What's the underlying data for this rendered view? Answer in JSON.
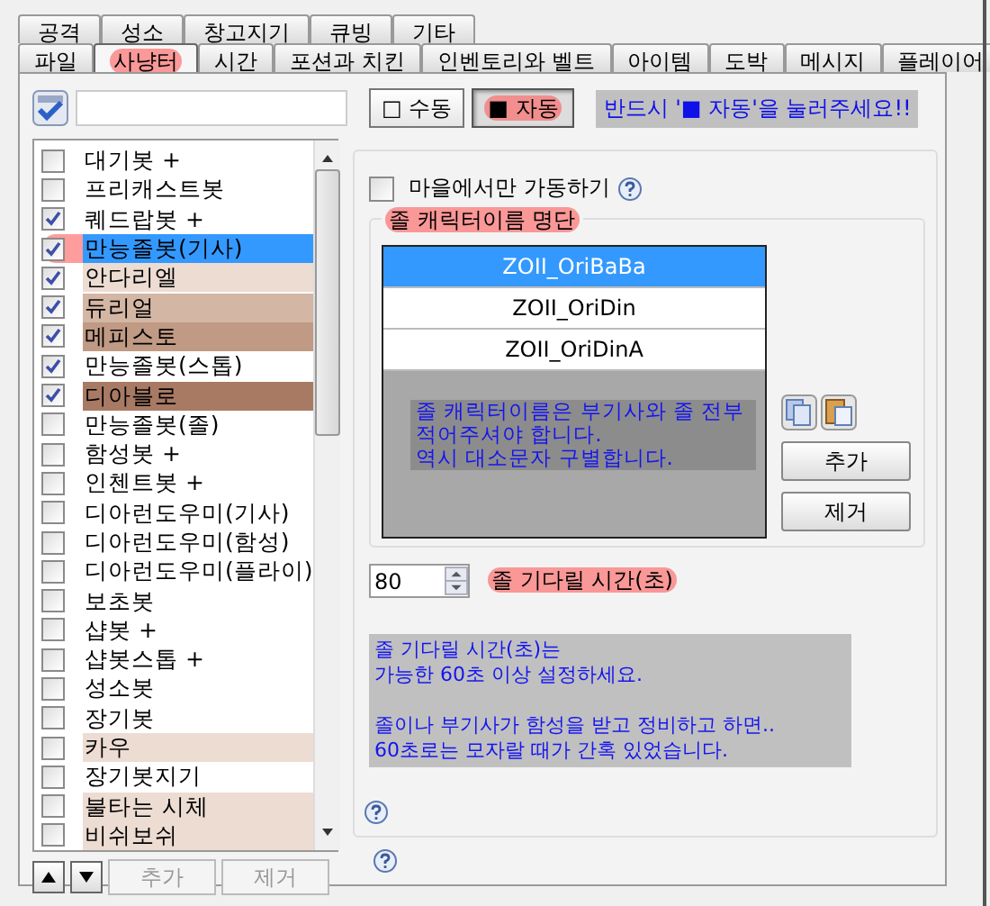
{
  "tabs": {
    "rows": [
      [
        {
          "label": "공격",
          "selected": false,
          "marked": false
        },
        {
          "label": "성소",
          "selected": false,
          "marked": false
        },
        {
          "label": "창고지기",
          "selected": false,
          "marked": false
        },
        {
          "label": "큐빙",
          "selected": false,
          "marked": false
        },
        {
          "label": "기타",
          "selected": false,
          "marked": false
        }
      ],
      [
        {
          "label": "파일",
          "selected": false,
          "marked": false
        },
        {
          "label": "사냥터",
          "selected": true,
          "marked": true
        },
        {
          "label": "시간",
          "selected": false,
          "marked": false
        },
        {
          "label": "포션과 치킨",
          "selected": false,
          "marked": false
        },
        {
          "label": "인벤토리와 벨트",
          "selected": false,
          "marked": false
        },
        {
          "label": "아이템",
          "selected": false,
          "marked": false
        },
        {
          "label": "도박",
          "selected": false,
          "marked": false
        },
        {
          "label": "메시지",
          "selected": false,
          "marked": false
        },
        {
          "label": "플레이어",
          "selected": false,
          "marked": false
        }
      ]
    ]
  },
  "mode_buttons": [
    {
      "label": "□ 수동",
      "pressed": false,
      "marked": false
    },
    {
      "label": "■ 자동",
      "pressed": true,
      "marked": true
    }
  ],
  "mode_notice": "반드시 '■ 자동'을 눌러주세요!!",
  "areas": [
    {
      "name": "대기봇 +",
      "checked": false,
      "selected": false,
      "marked": false
    },
    {
      "name": "프리캐스트봇",
      "checked": false,
      "selected": false,
      "marked": false
    },
    {
      "name": "퀘드랍봇 +",
      "checked": true,
      "selected": false,
      "marked": false
    },
    {
      "name": "만능졸봇(기사)",
      "checked": true,
      "selected": true,
      "marked": true
    },
    {
      "name": "안다리엘",
      "checked": true,
      "selected": false,
      "marked": false,
      "color": "#ecdcd2"
    },
    {
      "name": "듀리얼",
      "checked": true,
      "selected": false,
      "marked": false,
      "color": "#d4b6a4"
    },
    {
      "name": "메피스토",
      "checked": true,
      "selected": false,
      "marked": false,
      "color": "#c09a84"
    },
    {
      "name": "만능졸봇(스톱)",
      "checked": true,
      "selected": false,
      "marked": false
    },
    {
      "name": "디아블로",
      "checked": true,
      "selected": false,
      "marked": false,
      "color": "#a87a64"
    },
    {
      "name": "만능졸봇(졸)",
      "checked": false,
      "selected": false,
      "marked": false
    },
    {
      "name": "함성봇 +",
      "checked": false,
      "selected": false,
      "marked": false
    },
    {
      "name": "인첸트봇 +",
      "checked": false,
      "selected": false,
      "marked": false
    },
    {
      "name": "디아런도우미(기사)",
      "checked": false,
      "selected": false,
      "marked": false
    },
    {
      "name": "디아런도우미(함성)",
      "checked": false,
      "selected": false,
      "marked": false
    },
    {
      "name": "디아런도우미(플라이)",
      "checked": false,
      "selected": false,
      "marked": false
    },
    {
      "name": "보초봇",
      "checked": false,
      "selected": false,
      "marked": false
    },
    {
      "name": "샵봇 +",
      "checked": false,
      "selected": false,
      "marked": false
    },
    {
      "name": "샵봇스톱 +",
      "checked": false,
      "selected": false,
      "marked": false
    },
    {
      "name": "성소봇",
      "checked": false,
      "selected": false,
      "marked": false
    },
    {
      "name": "장기봇",
      "checked": false,
      "selected": false,
      "marked": false
    },
    {
      "name": "카우",
      "checked": false,
      "selected": false,
      "marked": false,
      "color": "#ecdcd2"
    },
    {
      "name": "장기봇지기",
      "checked": false,
      "selected": false,
      "marked": false
    },
    {
      "name": "불타는 시체",
      "checked": false,
      "selected": false,
      "marked": false,
      "color": "#ecdcd2"
    },
    {
      "name": "비쉬보쉬",
      "checked": false,
      "selected": false,
      "marked": false,
      "color": "#ecdcd2"
    }
  ],
  "list_buttons": [
    {
      "label": "추가",
      "disabled": true
    },
    {
      "label": "제거",
      "disabled": true
    }
  ],
  "town_only": {
    "label": "마을에서만 가동하기",
    "checked": false
  },
  "names_group": {
    "title": "졸 캐릭터이름 명단",
    "marked": true,
    "names": [
      {
        "name": "ZOII_OriBaBa",
        "selected": true
      },
      {
        "name": "ZOII_OriDin",
        "selected": false
      },
      {
        "name": "ZOII_OriDinA",
        "selected": false
      }
    ],
    "note": [
      "졸 캐릭터이름은 부기사와 졸 전부",
      "적어주셔야 합니다.",
      "역시 대소문자 구별합니다."
    ],
    "buttons": [
      "추가",
      "제거"
    ]
  },
  "wait_time": {
    "value": "80",
    "label": "졸 기다릴 시간(초)",
    "marked": true
  },
  "wait_note": [
    [
      "졸 기다릴 시간(초)는",
      "가능한 60초 이상 설정하세요."
    ],
    [
      "졸이나 부기사가 함성을 받고 정비하고 하면..",
      "60초로는 모자랄 때가 간혹 있었습니다."
    ]
  ]
}
